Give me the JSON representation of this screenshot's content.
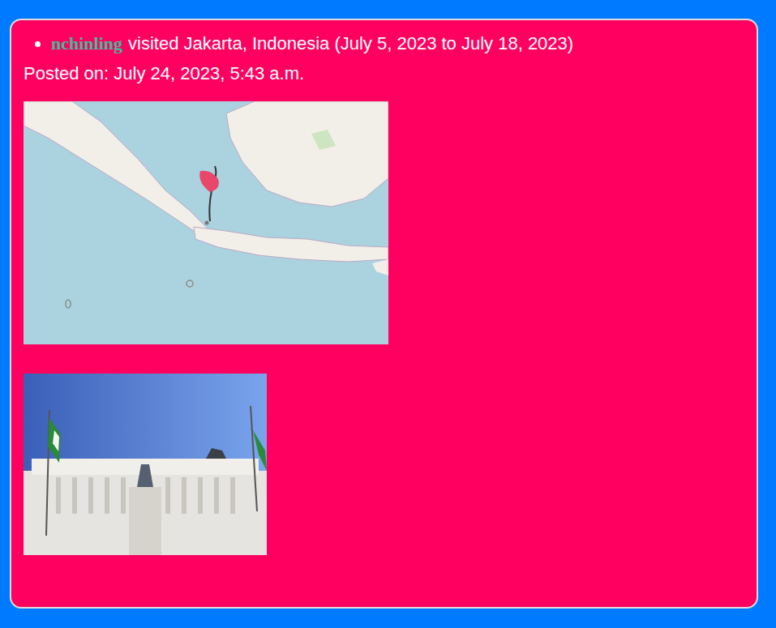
{
  "post": {
    "user": "nchinling",
    "summary": "visited Jakarta, Indonesia (July 5, 2023 to July 18, 2023)",
    "posted": "Posted on: July 24, 2023, 5:43 a.m."
  }
}
